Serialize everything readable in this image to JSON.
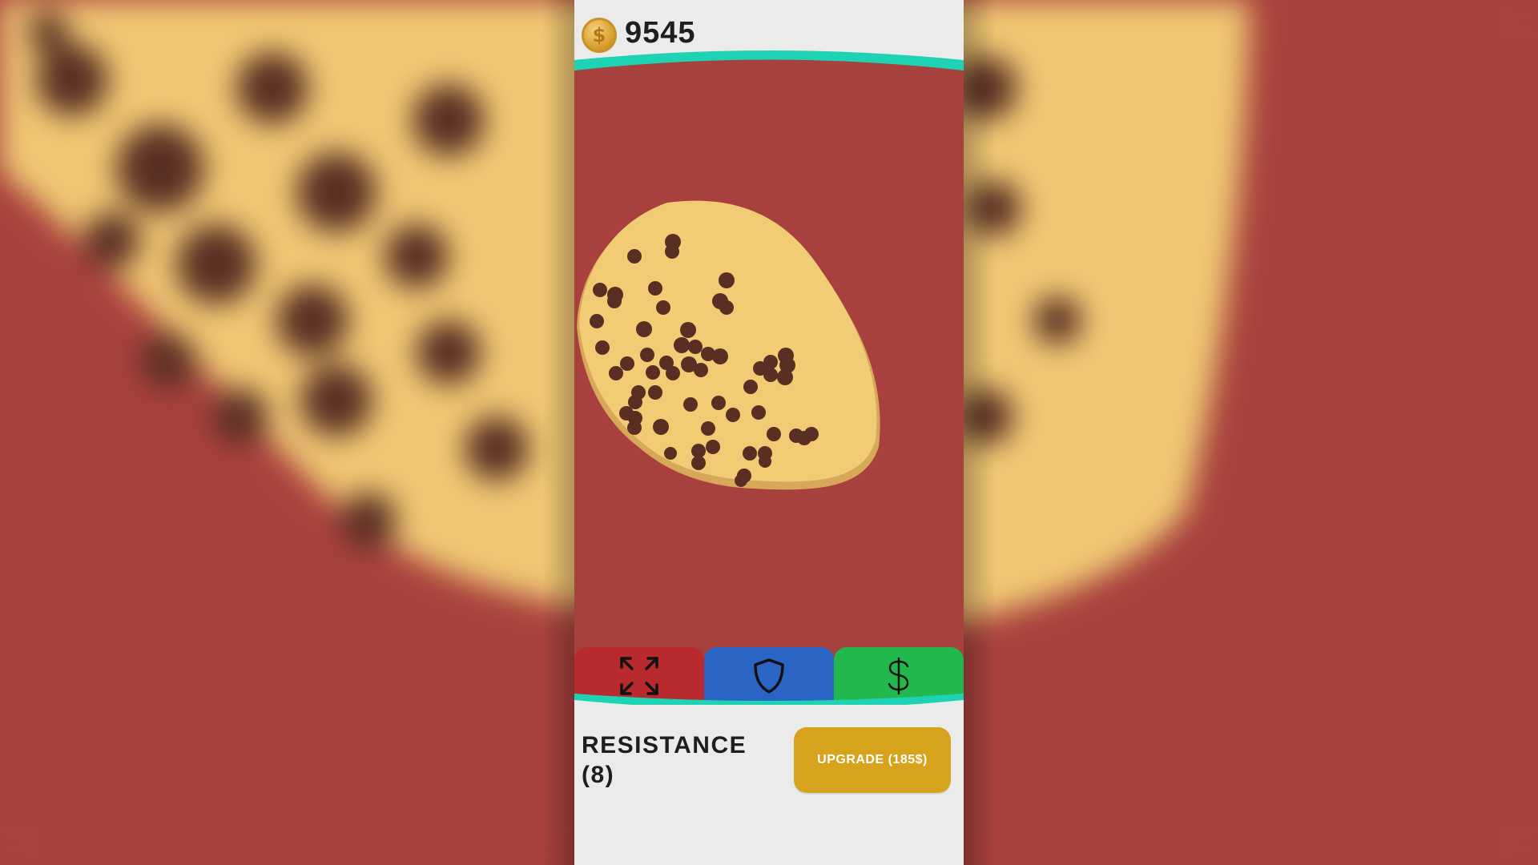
{
  "hud": {
    "coin_icon": "coin-icon",
    "coin_symbol": "$",
    "coin_count": "9545"
  },
  "tabs": [
    {
      "name": "expand",
      "icon": "expand-arrows-icon",
      "color": "#b82a2d"
    },
    {
      "name": "shield",
      "icon": "shield-icon",
      "color": "#2a64c4"
    },
    {
      "name": "money",
      "icon": "dollar-icon",
      "color": "#23b84e"
    }
  ],
  "upgrade_panel": {
    "stat_label": "RESISTANCE",
    "stat_level": "(8)",
    "upgrade_label": "UPGRADE (185$)"
  },
  "colors": {
    "background_red": "#a8413d",
    "cookie": "#f2cb75",
    "chip": "#5a2f23",
    "teal_accent": "#1ed3b3",
    "upgrade_gold": "#d8a31c",
    "panel_grey": "#ebebeb"
  }
}
